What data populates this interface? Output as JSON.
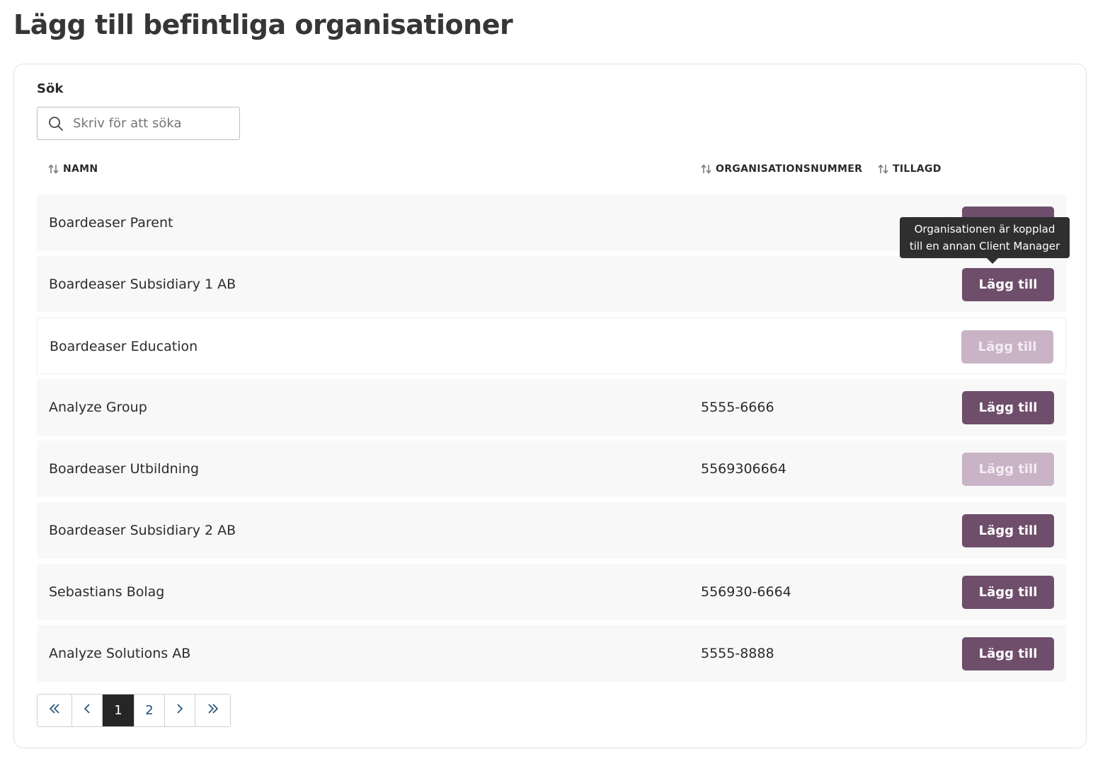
{
  "page": {
    "title": "Lägg till befintliga organisationer"
  },
  "search": {
    "label": "Sök",
    "placeholder": "Skriv för att söka",
    "value": ""
  },
  "table": {
    "columns": {
      "name": "NAMN",
      "orgnr": "ORGANISATIONSNUMMER",
      "added": "TILLAGD"
    },
    "rows": [
      {
        "name": "Boardeaser Parent",
        "orgnr": "",
        "button": "Lägg till",
        "disabled": false
      },
      {
        "name": "Boardeaser Subsidiary 1 AB",
        "orgnr": "",
        "button": "Lägg till",
        "disabled": false
      },
      {
        "name": "Boardeaser Education",
        "orgnr": "",
        "button": "Lägg till",
        "disabled": true
      },
      {
        "name": "Analyze Group",
        "orgnr": "5555-6666",
        "button": "Lägg till",
        "disabled": false
      },
      {
        "name": "Boardeaser Utbildning",
        "orgnr": "5569306664",
        "button": "Lägg till",
        "disabled": true
      },
      {
        "name": "Boardeaser Subsidiary 2 AB",
        "orgnr": "",
        "button": "Lägg till",
        "disabled": false
      },
      {
        "name": "Sebastians Bolag",
        "orgnr": "556930-6664",
        "button": "Lägg till",
        "disabled": false
      },
      {
        "name": "Analyze Solutions AB",
        "orgnr": "5555-8888",
        "button": "Lägg till",
        "disabled": false
      }
    ]
  },
  "tooltip": {
    "line1": "Organisationen är kopplad",
    "line2": "till en annan Client Manager"
  },
  "pagination": {
    "first": "«",
    "prev": "‹",
    "pages": [
      "1",
      "2"
    ],
    "current": "1",
    "next": "›",
    "last": "»"
  },
  "colors": {
    "button": "#6e4e6b",
    "button_disabled": "#c9b3c6",
    "row_bg": "#f8f8f8",
    "active_page": "#262626",
    "tooltip_bg": "#2f2f2f"
  },
  "icons": {
    "search": "search-icon",
    "sort": "sort-icon",
    "first": "double-chevron-left-icon",
    "prev": "chevron-left-icon",
    "next": "chevron-right-icon",
    "last": "double-chevron-right-icon"
  }
}
